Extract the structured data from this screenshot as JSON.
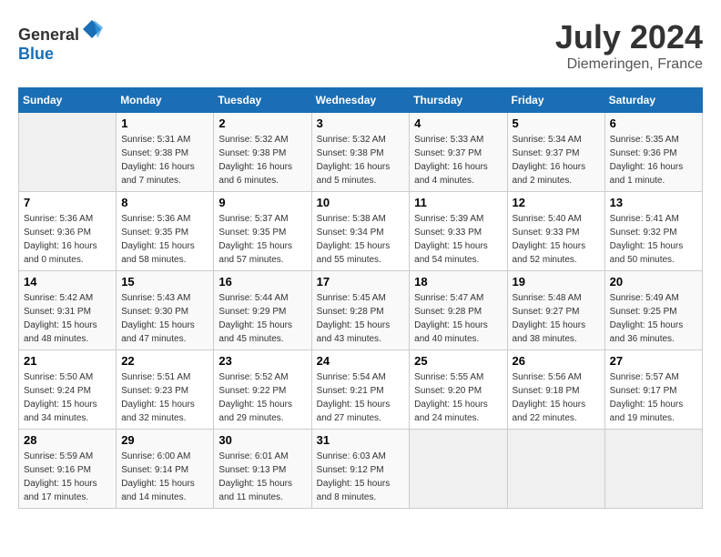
{
  "header": {
    "logo_general": "General",
    "logo_blue": "Blue",
    "month_year": "July 2024",
    "location": "Diemeringen, France"
  },
  "days_of_week": [
    "Sunday",
    "Monday",
    "Tuesday",
    "Wednesday",
    "Thursday",
    "Friday",
    "Saturday"
  ],
  "weeks": [
    [
      {
        "day": "",
        "sunrise": "",
        "sunset": "",
        "daylight": ""
      },
      {
        "day": "1",
        "sunrise": "5:31 AM",
        "sunset": "9:38 PM",
        "daylight": "16 hours and 7 minutes."
      },
      {
        "day": "2",
        "sunrise": "5:32 AM",
        "sunset": "9:38 PM",
        "daylight": "16 hours and 6 minutes."
      },
      {
        "day": "3",
        "sunrise": "5:32 AM",
        "sunset": "9:38 PM",
        "daylight": "16 hours and 5 minutes."
      },
      {
        "day": "4",
        "sunrise": "5:33 AM",
        "sunset": "9:37 PM",
        "daylight": "16 hours and 4 minutes."
      },
      {
        "day": "5",
        "sunrise": "5:34 AM",
        "sunset": "9:37 PM",
        "daylight": "16 hours and 2 minutes."
      },
      {
        "day": "6",
        "sunrise": "5:35 AM",
        "sunset": "9:36 PM",
        "daylight": "16 hours and 1 minute."
      }
    ],
    [
      {
        "day": "7",
        "sunrise": "5:36 AM",
        "sunset": "9:36 PM",
        "daylight": "16 hours and 0 minutes."
      },
      {
        "day": "8",
        "sunrise": "5:36 AM",
        "sunset": "9:35 PM",
        "daylight": "15 hours and 58 minutes."
      },
      {
        "day": "9",
        "sunrise": "5:37 AM",
        "sunset": "9:35 PM",
        "daylight": "15 hours and 57 minutes."
      },
      {
        "day": "10",
        "sunrise": "5:38 AM",
        "sunset": "9:34 PM",
        "daylight": "15 hours and 55 minutes."
      },
      {
        "day": "11",
        "sunrise": "5:39 AM",
        "sunset": "9:33 PM",
        "daylight": "15 hours and 54 minutes."
      },
      {
        "day": "12",
        "sunrise": "5:40 AM",
        "sunset": "9:33 PM",
        "daylight": "15 hours and 52 minutes."
      },
      {
        "day": "13",
        "sunrise": "5:41 AM",
        "sunset": "9:32 PM",
        "daylight": "15 hours and 50 minutes."
      }
    ],
    [
      {
        "day": "14",
        "sunrise": "5:42 AM",
        "sunset": "9:31 PM",
        "daylight": "15 hours and 48 minutes."
      },
      {
        "day": "15",
        "sunrise": "5:43 AM",
        "sunset": "9:30 PM",
        "daylight": "15 hours and 47 minutes."
      },
      {
        "day": "16",
        "sunrise": "5:44 AM",
        "sunset": "9:29 PM",
        "daylight": "15 hours and 45 minutes."
      },
      {
        "day": "17",
        "sunrise": "5:45 AM",
        "sunset": "9:28 PM",
        "daylight": "15 hours and 43 minutes."
      },
      {
        "day": "18",
        "sunrise": "5:47 AM",
        "sunset": "9:28 PM",
        "daylight": "15 hours and 40 minutes."
      },
      {
        "day": "19",
        "sunrise": "5:48 AM",
        "sunset": "9:27 PM",
        "daylight": "15 hours and 38 minutes."
      },
      {
        "day": "20",
        "sunrise": "5:49 AM",
        "sunset": "9:25 PM",
        "daylight": "15 hours and 36 minutes."
      }
    ],
    [
      {
        "day": "21",
        "sunrise": "5:50 AM",
        "sunset": "9:24 PM",
        "daylight": "15 hours and 34 minutes."
      },
      {
        "day": "22",
        "sunrise": "5:51 AM",
        "sunset": "9:23 PM",
        "daylight": "15 hours and 32 minutes."
      },
      {
        "day": "23",
        "sunrise": "5:52 AM",
        "sunset": "9:22 PM",
        "daylight": "15 hours and 29 minutes."
      },
      {
        "day": "24",
        "sunrise": "5:54 AM",
        "sunset": "9:21 PM",
        "daylight": "15 hours and 27 minutes."
      },
      {
        "day": "25",
        "sunrise": "5:55 AM",
        "sunset": "9:20 PM",
        "daylight": "15 hours and 24 minutes."
      },
      {
        "day": "26",
        "sunrise": "5:56 AM",
        "sunset": "9:18 PM",
        "daylight": "15 hours and 22 minutes."
      },
      {
        "day": "27",
        "sunrise": "5:57 AM",
        "sunset": "9:17 PM",
        "daylight": "15 hours and 19 minutes."
      }
    ],
    [
      {
        "day": "28",
        "sunrise": "5:59 AM",
        "sunset": "9:16 PM",
        "daylight": "15 hours and 17 minutes."
      },
      {
        "day": "29",
        "sunrise": "6:00 AM",
        "sunset": "9:14 PM",
        "daylight": "15 hours and 14 minutes."
      },
      {
        "day": "30",
        "sunrise": "6:01 AM",
        "sunset": "9:13 PM",
        "daylight": "15 hours and 11 minutes."
      },
      {
        "day": "31",
        "sunrise": "6:03 AM",
        "sunset": "9:12 PM",
        "daylight": "15 hours and 8 minutes."
      },
      {
        "day": "",
        "sunrise": "",
        "sunset": "",
        "daylight": ""
      },
      {
        "day": "",
        "sunrise": "",
        "sunset": "",
        "daylight": ""
      },
      {
        "day": "",
        "sunrise": "",
        "sunset": "",
        "daylight": ""
      }
    ]
  ]
}
